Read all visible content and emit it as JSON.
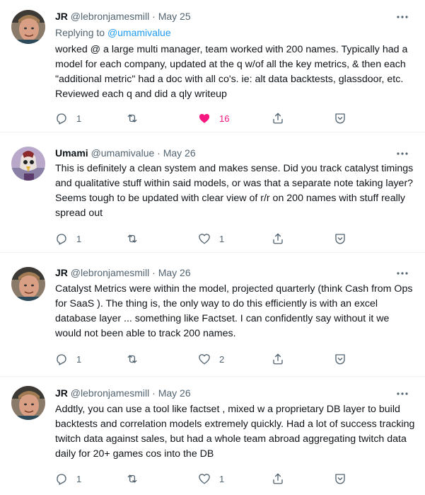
{
  "tweets": [
    {
      "author": "JR",
      "handle": "@lebronjamesmill",
      "date": "May 25",
      "replying_prefix": "Replying to",
      "replying_to": "@umamivalue",
      "text": "worked @ a large multi manager, team worked with 200 names. Typically had a model for each company, updated at the q w/of all the key metrics, & then each \"additional metric\" had a doc with all co's. ie: alt data backtests, glassdoor, etc. Reviewed each q and did a qly writeup",
      "replies": "1",
      "retweets": "",
      "likes": "16",
      "liked": true
    },
    {
      "author": "Umami",
      "handle": "@umamivalue",
      "date": "May 26",
      "text": "This is definitely a clean system and makes sense. Did you track catalyst timings and qualitative stuff within said models, or was that a separate note taking layer? Seems tough to be updated with clear view of r/r on 200 names with stuff really spread out",
      "replies": "1",
      "retweets": "",
      "likes": "1",
      "liked": false
    },
    {
      "author": "JR",
      "handle": "@lebronjamesmill",
      "date": "May 26",
      "text": "Catalyst Metrics were within the model, projected quarterly (think Cash from Ops for SaaS ). The thing is, the only way to do this efficiently is with an excel database layer ... something like Factset. I can confidently say without it we would not been able to track 200 names.",
      "replies": "1",
      "retweets": "",
      "likes": "2",
      "liked": false
    },
    {
      "author": "JR",
      "handle": "@lebronjamesmill",
      "date": "May 26",
      "text": "Addtly, you can use a tool like factset , mixed w a proprietary DB layer to build backtests and correlation models extremely quickly. Had a lot of success tracking twitch data against sales, but had a whole team abroad aggregating twitch data daily for 20+ games cos into the DB",
      "replies": "1",
      "retweets": "",
      "likes": "1",
      "liked": false
    }
  ],
  "separator": "·",
  "colors": {
    "text": "#0f1419",
    "muted": "#536471",
    "link": "#1d9bf0",
    "like": "#f91880",
    "divider": "#eff3f4"
  },
  "icons": [
    "reply-icon",
    "retweet-icon",
    "heart-icon",
    "share-icon",
    "bookmark-icon",
    "more-icon"
  ]
}
